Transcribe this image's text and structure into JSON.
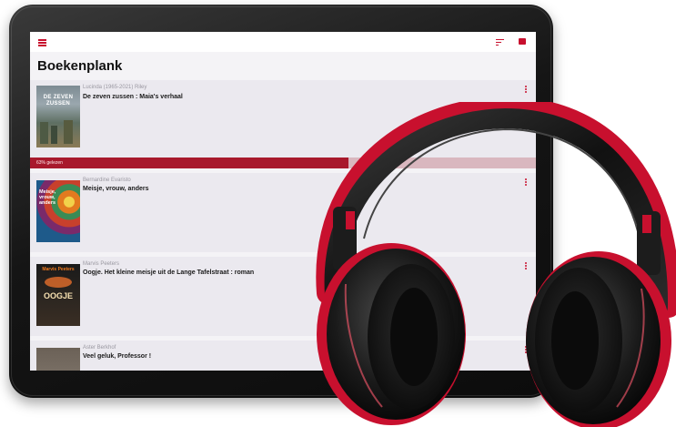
{
  "app": {
    "title": "Boekenplank"
  },
  "toolbar": {
    "icons": [
      "menu-icon",
      "sort-icon",
      "grid-view-icon"
    ]
  },
  "colors": {
    "accent": "#c8102e",
    "card_background": "#ebe9ef",
    "progress_fill": "#a8192c",
    "progress_track": "#d9b7bf"
  },
  "books": [
    {
      "author": "Lucinda (1965-2021) Riley",
      "title": "De zeven zussen : Maia's verhaal",
      "progress_label": "63% gelezen",
      "progress_percent": 63,
      "cover_text": "DE ZEVEN ZUSSEN"
    },
    {
      "author": "Bernardine Evaristo",
      "title": "Meisje, vrouw, anders",
      "cover_text": "Meisje, vrouw, anders"
    },
    {
      "author": "Marvis Peeters",
      "title": "Oogje. Het kleine meisje uit de Lange Tafelstraat : roman",
      "cover_author": "Marvis Peeters",
      "cover_text": "OOGJE"
    },
    {
      "author": "Aster Berkhof",
      "title": "Veel geluk, Professor !"
    }
  ]
}
